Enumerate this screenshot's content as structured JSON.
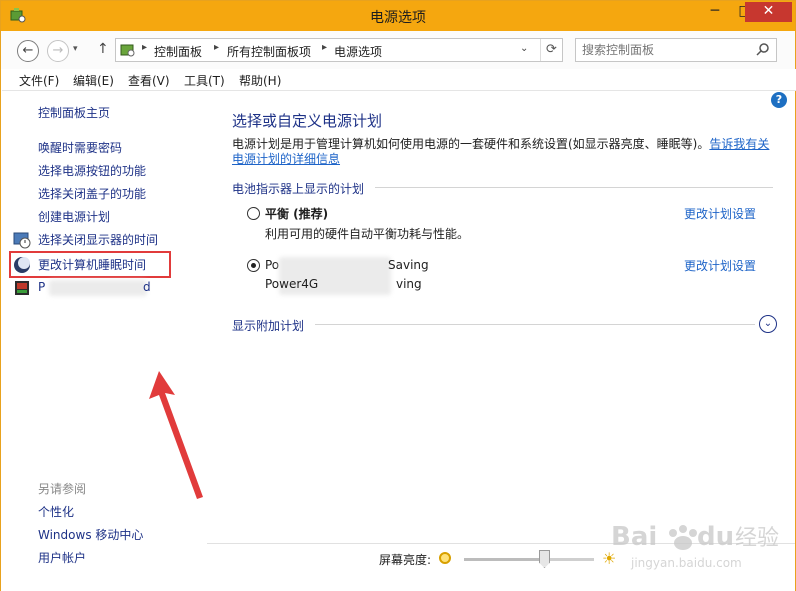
{
  "window": {
    "title": "电源选项"
  },
  "controls": {
    "minimize": "─",
    "maximize": "□",
    "close": "✕"
  },
  "nav": {
    "back": "←",
    "forward": "→",
    "recent": "▾",
    "up": "↑",
    "refresh": "⟳",
    "dropdown": "⌄"
  },
  "breadcrumb": [
    "控制面板",
    "所有控制面板项",
    "电源选项"
  ],
  "breadcrumb_separator": "▸",
  "search": {
    "placeholder": "搜索控制面板"
  },
  "menu": [
    "文件(F)",
    "编辑(E)",
    "查看(V)",
    "工具(T)",
    "帮助(H)"
  ],
  "sidebar": {
    "home": "控制面板主页",
    "items": [
      "唤醒时需要密码",
      "选择电源按钮的功能",
      "选择关闭盖子的功能",
      "创建电源计划",
      "选择关闭显示器的时间",
      "更改计算机睡眠时间"
    ],
    "partial_item": {
      "start": "P",
      "end": "d"
    },
    "see_also_title": "另请参阅",
    "see_also": [
      "个性化",
      "Windows 移动中心",
      "用户帐户"
    ]
  },
  "main": {
    "help": "?",
    "title": "选择或自定义电源计划",
    "description": "电源计划是用于管理计算机如何使用电源的一套硬件和系统设置(如显示器亮度、睡眠等)。",
    "description_link": "告诉我有关电源计划的详细信息",
    "group_battery": "电池指示器上显示的计划",
    "plans": [
      {
        "name": "平衡 (推荐)",
        "desc": "利用可用的硬件自动平衡功耗与性能。",
        "link": "更改计划设置",
        "selected": false
      },
      {
        "name_start": "Po",
        "name_end": "Saving",
        "desc_start": "Power4G",
        "desc_end": "ving",
        "link": "更改计划设置",
        "selected": true
      }
    ],
    "group_additional": "显示附加计划",
    "expand_glyph": "⌄"
  },
  "brightness": {
    "label": "屏幕亮度:",
    "level_percent": 62
  },
  "colors": {
    "title_bar": "#f5a70f",
    "link": "#1e3287",
    "highlight": "#e13b3b"
  }
}
